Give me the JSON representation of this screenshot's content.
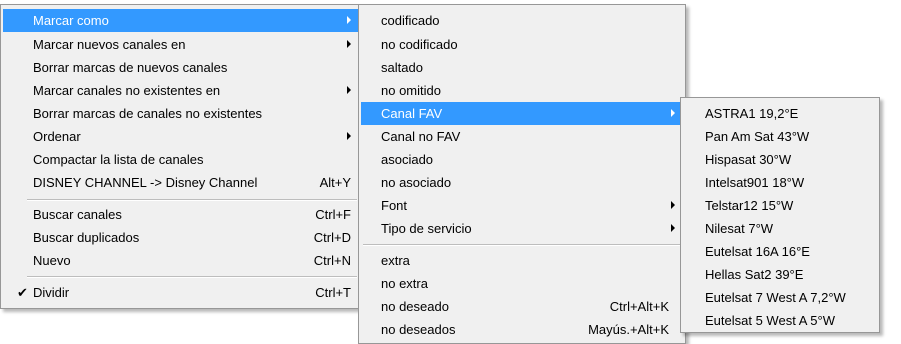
{
  "menu1": {
    "items": [
      {
        "label": "Marcar como"
      },
      {
        "label": "Marcar nuevos canales en"
      },
      {
        "label": "Borrar marcas de nuevos canales"
      },
      {
        "label": "Marcar canales no existentes en"
      },
      {
        "label": "Borrar marcas de canales no existentes"
      },
      {
        "label": "Ordenar"
      },
      {
        "label": "Compactar la lista de canales"
      },
      {
        "label": "DISNEY CHANNEL -> Disney Channel",
        "shortcut": "Alt+Y"
      },
      {
        "label": "Buscar canales",
        "shortcut": "Ctrl+F"
      },
      {
        "label": "Buscar duplicados",
        "shortcut": "Ctrl+D"
      },
      {
        "label": "Nuevo",
        "shortcut": "Ctrl+N"
      },
      {
        "label": "Dividir",
        "shortcut": "Ctrl+T",
        "check": "✔"
      }
    ]
  },
  "menu2": {
    "items": [
      {
        "label": "codificado"
      },
      {
        "label": "no codificado"
      },
      {
        "label": "saltado"
      },
      {
        "label": "no omitido"
      },
      {
        "label": "Canal FAV"
      },
      {
        "label": "Canal no FAV"
      },
      {
        "label": "asociado"
      },
      {
        "label": "no asociado"
      },
      {
        "label": "Font"
      },
      {
        "label": "Tipo de servicio"
      },
      {
        "label": "extra"
      },
      {
        "label": "no extra"
      },
      {
        "label": "no deseado",
        "shortcut": "Ctrl+Alt+K"
      },
      {
        "label": "no deseados",
        "shortcut": "Mayús.+Alt+K"
      }
    ]
  },
  "menu3": {
    "items": [
      {
        "label": "ASTRA1 19,2°E"
      },
      {
        "label": "Pan Am Sat 43°W"
      },
      {
        "label": "Hispasat 30°W"
      },
      {
        "label": "Intelsat901 18°W"
      },
      {
        "label": "Telstar12 15°W"
      },
      {
        "label": "Nilesat 7°W"
      },
      {
        "label": "Eutelsat 16A 16°E"
      },
      {
        "label": "Hellas Sat2 39°E"
      },
      {
        "label": "Eutelsat 7 West A 7,2°W"
      },
      {
        "label": "Eutelsat 5 West A 5°W"
      }
    ]
  },
  "colors": {
    "highlight": "#3399ff",
    "menu_bg": "#f0f0f0"
  }
}
